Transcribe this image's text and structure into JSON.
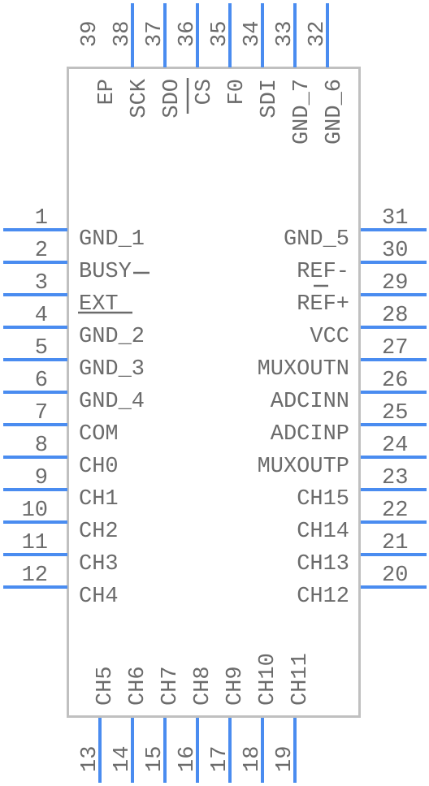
{
  "component": {
    "type": "IC symbol (QFN package pinout)",
    "colors": {
      "pin": "#4a8cf0",
      "outline": "#c0c0c0",
      "text": "#6b6b6b",
      "background": "#ffffff"
    }
  },
  "pins": {
    "left": [
      {
        "number": "1",
        "name": "GND_1"
      },
      {
        "number": "2",
        "name": "BUSY",
        "overline_note": "bar drawn over Y"
      },
      {
        "number": "3",
        "name": "EXT",
        "overline": true
      },
      {
        "number": "4",
        "name": "GND_2"
      },
      {
        "number": "5",
        "name": "GND_3"
      },
      {
        "number": "6",
        "name": "GND_4"
      },
      {
        "number": "7",
        "name": "COM"
      },
      {
        "number": "8",
        "name": "CH0"
      },
      {
        "number": "9",
        "name": "CH1"
      },
      {
        "number": "10",
        "name": "CH2"
      },
      {
        "number": "11",
        "name": "CH3"
      },
      {
        "number": "12",
        "name": "CH4"
      }
    ],
    "bottom": [
      {
        "number": "13",
        "name": "CH5"
      },
      {
        "number": "14",
        "name": "CH6"
      },
      {
        "number": "15",
        "name": "CH7"
      },
      {
        "number": "16",
        "name": "CH8"
      },
      {
        "number": "17",
        "name": "CH9"
      },
      {
        "number": "18",
        "name": "CH10"
      },
      {
        "number": "19",
        "name": "CH11"
      }
    ],
    "right": [
      {
        "number": "31",
        "name": "GND_5"
      },
      {
        "number": "30",
        "name": "REF-",
        "overline_note": "bar drawn over F"
      },
      {
        "number": "29",
        "name": "REF+"
      },
      {
        "number": "28",
        "name": "VCC"
      },
      {
        "number": "27",
        "name": "MUXOUTN"
      },
      {
        "number": "26",
        "name": "ADCINN"
      },
      {
        "number": "25",
        "name": "ADCINP"
      },
      {
        "number": "24",
        "name": "MUXOUTP"
      },
      {
        "number": "23",
        "name": "CH15"
      },
      {
        "number": "22",
        "name": "CH14"
      },
      {
        "number": "21",
        "name": "CH13"
      },
      {
        "number": "20",
        "name": "CH12"
      }
    ],
    "top": [
      {
        "number": "39",
        "name": "EP",
        "no_lead": true
      },
      {
        "number": "38",
        "name": "SCK"
      },
      {
        "number": "37",
        "name": "SDO"
      },
      {
        "number": "36",
        "name": "CS",
        "overline": true
      },
      {
        "number": "35",
        "name": "F0"
      },
      {
        "number": "34",
        "name": "SDI"
      },
      {
        "number": "33",
        "name": "GND_7"
      },
      {
        "number": "32",
        "name": "GND_6"
      }
    ]
  }
}
